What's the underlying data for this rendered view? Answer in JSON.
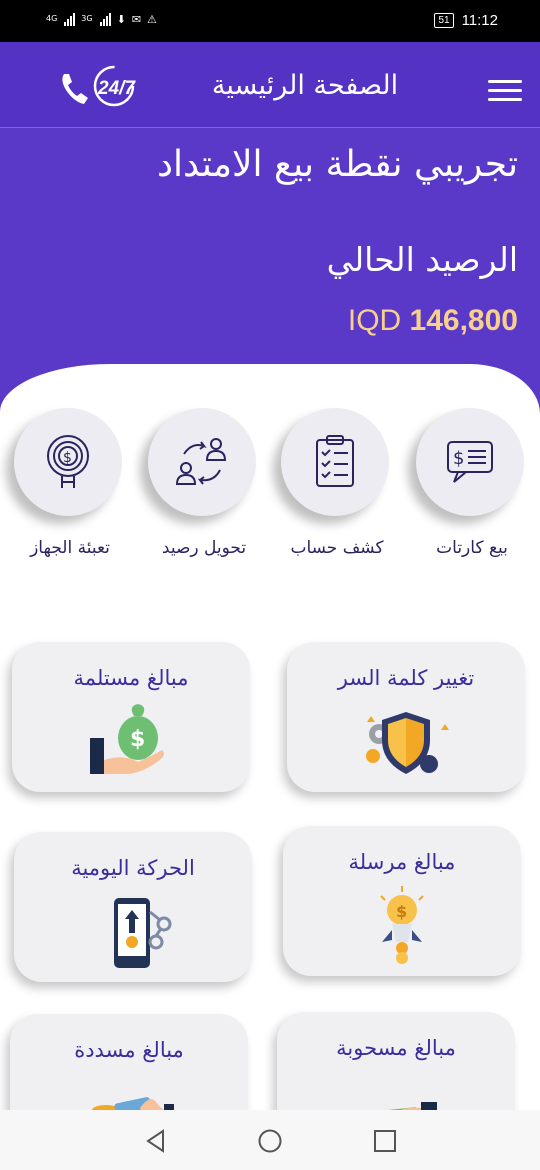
{
  "status_bar": {
    "net1": "4G",
    "net2": "3G",
    "battery": "51",
    "time": "11:12"
  },
  "header": {
    "title": "الصفحة الرئيسية",
    "logo_text": "24/7"
  },
  "account": {
    "merchant_name": "تجريبي نقطة بيع الامتداد",
    "balance_label": "الرصيد الحالي",
    "currency": "IQD",
    "balance": "146,800"
  },
  "quick_actions": [
    {
      "label": "بيع كارتات",
      "icon": "money-card-icon"
    },
    {
      "label": "كشف حساب",
      "icon": "clipboard-checklist-icon"
    },
    {
      "label": "تحويل رصيد",
      "icon": "transfer-users-icon"
    },
    {
      "label": "تعبئة الجهاز",
      "icon": "coin-touch-icon"
    }
  ],
  "cards": [
    {
      "label": "تغيير كلمة السر",
      "icon": "shield-gears-icon"
    },
    {
      "label": "مبالغ مستلمة",
      "icon": "money-bag-hand-icon"
    },
    {
      "label": "مبالغ مرسلة",
      "icon": "lightbulb-rocket-icon"
    },
    {
      "label": "الحركة اليومية",
      "icon": "phone-transfer-icon"
    },
    {
      "label": "مبالغ مسحوبة",
      "icon": "cash-hand-icon"
    },
    {
      "label": "مبالغ مسددة",
      "icon": "card-coins-icon"
    }
  ],
  "colors": {
    "primary": "#5a39c9",
    "accent_text": "#3a2d9c",
    "balance_text": "#f7d189"
  }
}
